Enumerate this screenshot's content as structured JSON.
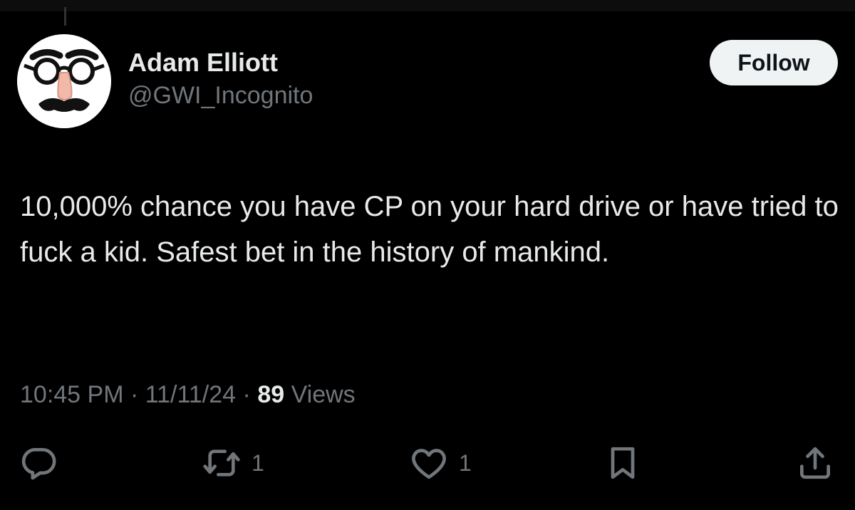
{
  "author": {
    "display_name": "Adam Elliott",
    "handle": "@GWI_Incognito",
    "avatar_icon": "groucho-glasses-disguise-icon"
  },
  "follow_label": "Follow",
  "tweet": {
    "text": "10,000% chance you have CP on your hard drive or have tried to fuck a kid. Safest bet in the history of mankind."
  },
  "meta": {
    "time": "10:45 PM",
    "separator": "·",
    "date": "11/11/24",
    "views_count": "89",
    "views_label": "Views"
  },
  "actions": {
    "reply_icon": "reply-bubble-icon",
    "retweet_icon": "retweet-icon",
    "retweet_count": "1",
    "like_icon": "heart-icon",
    "like_count": "1",
    "bookmark_icon": "bookmark-icon",
    "share_icon": "share-icon"
  },
  "colors": {
    "background": "#000000",
    "primary_text": "#e7e9ea",
    "secondary_text": "#71767b",
    "follow_bg": "#eff3f4",
    "follow_text": "#0f1419"
  }
}
